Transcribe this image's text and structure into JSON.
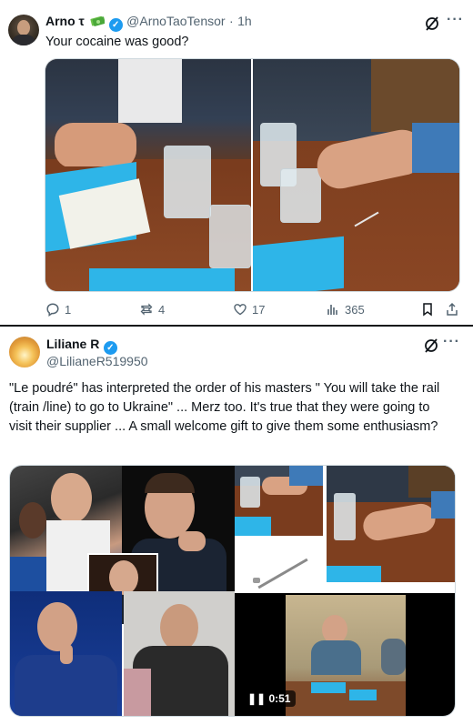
{
  "tweet1": {
    "display_name": "Arno τ",
    "handle": "@ArnoTaoTensor",
    "separator": "·",
    "time": "1h",
    "text": "Your cocaine was good?",
    "icons": [
      "money-icon",
      "verified-icon",
      "grok-icon",
      "more-icon"
    ],
    "actions": {
      "replies": "1",
      "reposts": "4",
      "likes": "17",
      "views": "365"
    }
  },
  "tweet2": {
    "display_name": "Liliane R",
    "handle": "@LilianeR519950",
    "text": "\"Le poudré\" has interpreted the order of his masters \" You will take the rail (train /line) to go to Ukraine\" ... Merz too.  It's true that they were going to visit their supplier ... A small welcome gift to give them some enthusiasm?",
    "icons": [
      "verified-icon",
      "grok-icon",
      "more-icon"
    ],
    "video_duration": "0:51"
  },
  "colors": {
    "verified": "#1d9bf0",
    "text": "#0f1419",
    "secondary": "#536471",
    "table_wood": "#7a3c1e",
    "blue_paper": "#2eb5e8"
  }
}
